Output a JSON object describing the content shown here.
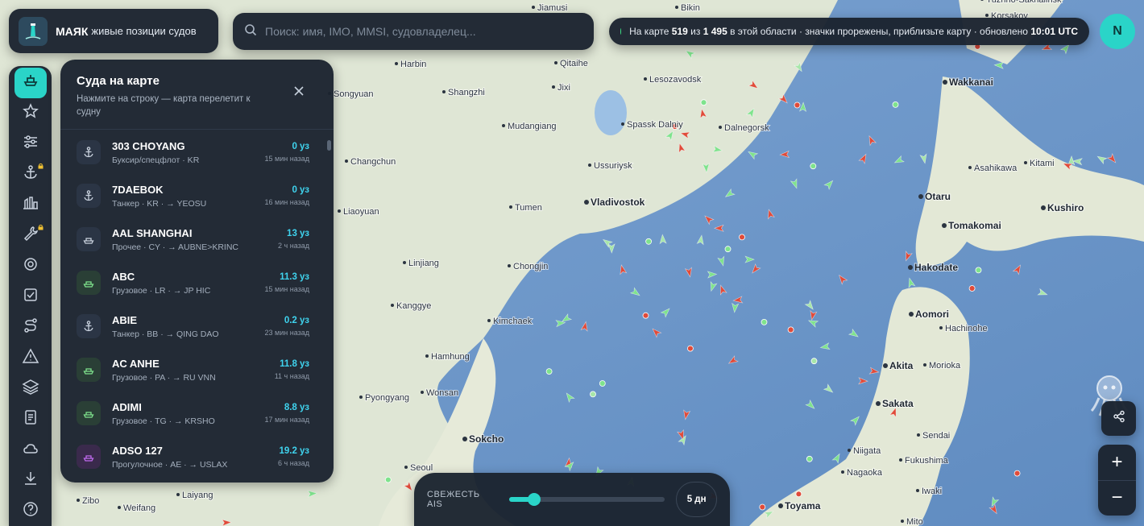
{
  "brand": {
    "title": "МАЯК",
    "subtitle": "живые позиции судов"
  },
  "search": {
    "placeholder": "Поиск: имя, IMO, MMSI, судовладелец..."
  },
  "status": {
    "prefix": "На карте",
    "shown": "519",
    "of": "из",
    "total": "1 495",
    "mid": "в этой области · значки прорежены, приблизьте карту · обновлено",
    "time": "10:01 UTC"
  },
  "user": {
    "initial": "N"
  },
  "rail": [
    {
      "icon": "ship-icon",
      "active": true,
      "locked": false
    },
    {
      "icon": "star-icon",
      "active": false,
      "locked": false
    },
    {
      "icon": "sliders-icon",
      "active": false,
      "locked": false
    },
    {
      "icon": "anchor-icon",
      "active": false,
      "locked": true
    },
    {
      "icon": "port-icon",
      "active": false,
      "locked": false
    },
    {
      "icon": "wrench-icon",
      "active": false,
      "locked": true
    },
    {
      "icon": "target-icon",
      "active": false,
      "locked": false
    },
    {
      "icon": "checklist-icon",
      "active": false,
      "locked": false
    },
    {
      "icon": "route-icon",
      "active": false,
      "locked": false
    },
    {
      "icon": "warning-icon",
      "active": false,
      "locked": false
    },
    {
      "icon": "layers-icon",
      "active": false,
      "locked": false
    },
    {
      "icon": "report-icon",
      "active": false,
      "locked": false
    },
    {
      "icon": "weather-icon",
      "active": false,
      "locked": false
    },
    {
      "icon": "download-icon",
      "active": false,
      "locked": false
    },
    {
      "icon": "help-icon",
      "active": false,
      "locked": false
    }
  ],
  "vessels": {
    "title": "Суда на карте",
    "subtitle": "Нажмите на строку — карта перелетит к судну",
    "items": [
      {
        "name": "303 CHOYANG",
        "meta": "Буксир/спецфлот · KR",
        "speed": "0 уз",
        "time": "15 мин назад",
        "kind": "anchor"
      },
      {
        "name": "7DAEBOK",
        "meta": "Танкер · KR · → YEOSU",
        "speed": "0 уз",
        "time": "16 мин назад",
        "kind": "anchor"
      },
      {
        "name": "AAL SHANGHAI",
        "meta": "Прочее · CY · → AUBNE>KRINC",
        "speed": "13 уз",
        "time": "2 ч назад",
        "kind": "other"
      },
      {
        "name": "ABC",
        "meta": "Грузовое · LR · → JP HIC",
        "speed": "11.3 уз",
        "time": "15 мин назад",
        "kind": "cargo"
      },
      {
        "name": "ABIE",
        "meta": "Танкер · BB · → QING DAO",
        "speed": "0.2 уз",
        "time": "23 мин назад",
        "kind": "anchor"
      },
      {
        "name": "AC ANHE",
        "meta": "Грузовое · PA · → RU VNN",
        "speed": "11.8 уз",
        "time": "11 ч назад",
        "kind": "cargo"
      },
      {
        "name": "ADIMI",
        "meta": "Грузовое · TG · → KRSHO",
        "speed": "8.8 уз",
        "time": "17 мин назад",
        "kind": "cargo"
      },
      {
        "name": "ADSO 127",
        "meta": "Прогулочное · AE · → USLAX",
        "speed": "19.2 уз",
        "time": "6 ч назад",
        "kind": "pleasure"
      }
    ]
  },
  "freshness": {
    "label": "СВЕЖЕСТЬ AIS",
    "value": "5 дн",
    "level_percent": 16
  },
  "zoom": {
    "in": "+",
    "out": "−"
  },
  "map": {
    "places": [
      "Jiamusi",
      "Bikin",
      "Harbin",
      "Qitaihe",
      "Lesozavodsk",
      "Shangzhi",
      "Jixi",
      "Songyuan",
      "Mudangiang",
      "Spassk Dalniy",
      "Dalnegorsk",
      "Changchun",
      "Ussuriysk",
      "Vladivostok",
      "Liaoyuan",
      "Tumen",
      "Linjiang",
      "Chongjin",
      "Kanggye",
      "Kimchaek",
      "Hamhung",
      "Wonsan",
      "Pyongyang",
      "Sokcho",
      "Seoul",
      "Weifang",
      "Laiyang",
      "Zibo",
      "Wakkanai",
      "Asahikawa",
      "Kitami",
      "Otaru",
      "Kushiro",
      "Tomakomai",
      "Hakodate",
      "Aomori",
      "Hachinohe",
      "Akita",
      "Morioka",
      "Sakata",
      "Sendai",
      "Niigata",
      "Fukushima",
      "Nagaoka",
      "Iwaki",
      "Toyama",
      "Mito",
      "Korsakov",
      "Yuzhno-Sakhalinsk"
    ]
  }
}
